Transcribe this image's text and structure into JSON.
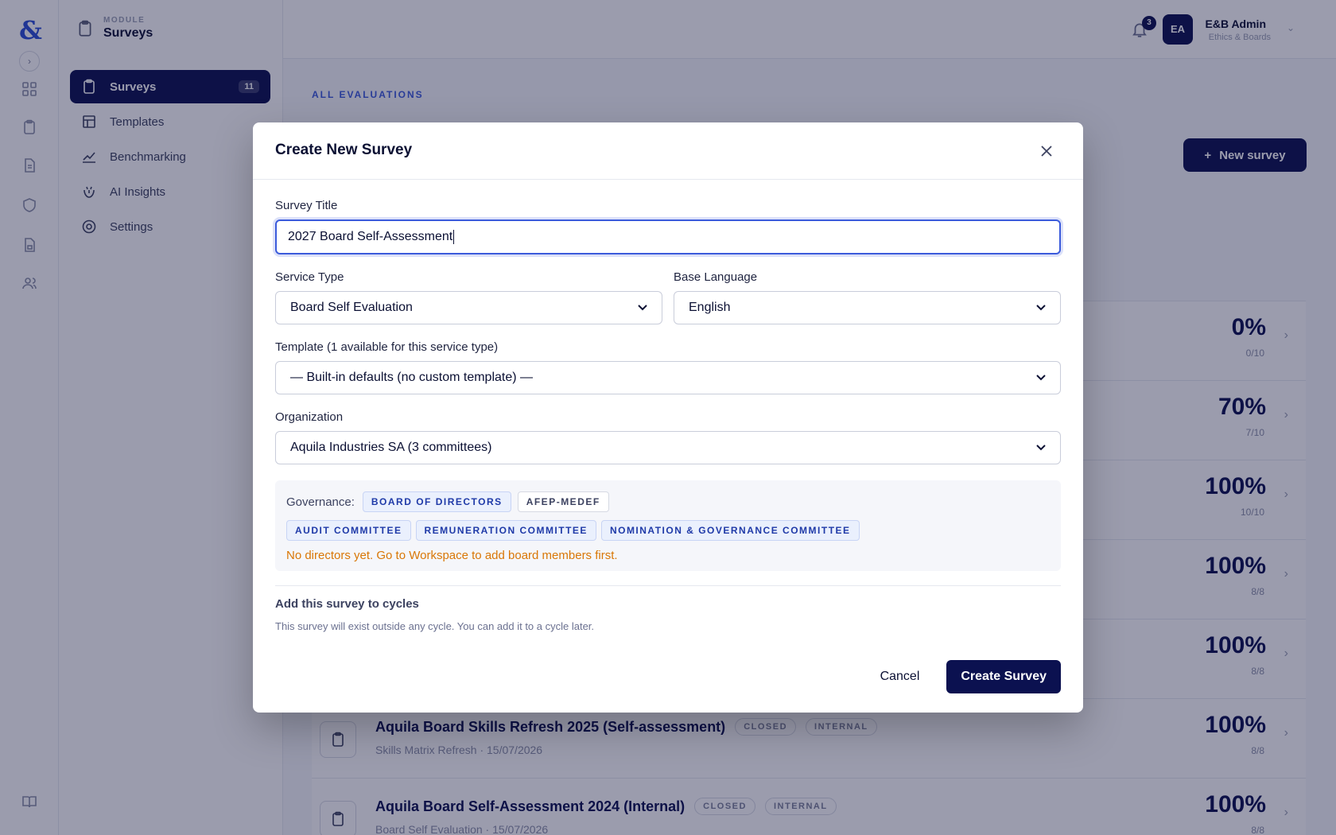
{
  "rail": {
    "logo": "&",
    "icons": [
      "grid-icon",
      "clipboard-icon",
      "document-icon",
      "shield-icon",
      "file-lock-icon",
      "users-icon"
    ]
  },
  "module": {
    "label": "MODULE",
    "title": "Surveys"
  },
  "subnav": {
    "items": [
      {
        "label": "Surveys",
        "count": "11",
        "icon": "clipboard-icon"
      },
      {
        "label": "Templates",
        "icon": "template-icon"
      },
      {
        "label": "Benchmarking",
        "icon": "chart-icon"
      },
      {
        "label": "AI Insights",
        "icon": "sparkle-icon"
      },
      {
        "label": "Settings",
        "icon": "gear-icon"
      }
    ]
  },
  "topbar": {
    "notifications": "3",
    "avatar": "EA",
    "user_name": "E&B Admin",
    "user_role": "Ethics & Boards"
  },
  "main": {
    "eyebrow": "ALL EVALUATIONS",
    "new_button": "New survey",
    "rows": [
      {
        "pct": "0%",
        "frac": "0/10"
      },
      {
        "pct": "70%",
        "frac": "7/10"
      },
      {
        "pct": "100%",
        "frac": "10/10"
      },
      {
        "pct": "100%",
        "frac": "8/8"
      },
      {
        "pct": "100%",
        "frac": "8/8"
      },
      {
        "title": "Aquila Board Skills Refresh 2025 (Self-assessment)",
        "status": "CLOSED",
        "scope": "INTERNAL",
        "meta": "Skills Matrix Refresh · 15/07/2026",
        "pct": "100%",
        "frac": "8/8"
      },
      {
        "title": "Aquila Board Self-Assessment 2024 (Internal)",
        "status": "CLOSED",
        "scope": "INTERNAL",
        "meta": "Board Self Evaluation · 15/07/2026",
        "pct": "100%",
        "frac": "8/8"
      }
    ]
  },
  "modal": {
    "title": "Create New Survey",
    "survey_title_label": "Survey Title",
    "survey_title_value": "2027 Board Self-Assessment",
    "service_type_label": "Service Type",
    "service_type_value": "Board Self Evaluation",
    "base_language_label": "Base Language",
    "base_language_value": "English",
    "template_label": "Template (1 available for this service type)",
    "template_value": "— Built-in defaults (no custom template) —",
    "organization_label": "Organization",
    "organization_value": "Aquila Industries SA (3 committees)",
    "governance_label": "Governance:",
    "governance_tags": [
      "BOARD OF DIRECTORS",
      "AFEP-MEDEF"
    ],
    "committee_tags": [
      "AUDIT COMMITTEE",
      "REMUNERATION COMMITTEE",
      "NOMINATION & GOVERNANCE COMMITTEE"
    ],
    "warning": "No directors yet. Go to Workspace to add board members first.",
    "cycles_title": "Add this survey to cycles",
    "cycles_desc": "This survey will exist outside any cycle. You can add it to a cycle later.",
    "cancel_label": "Cancel",
    "create_label": "Create Survey"
  },
  "colors": {
    "brand_navy": "#0b1150",
    "accent_blue": "#3b5bdb",
    "warning": "#d97706"
  }
}
